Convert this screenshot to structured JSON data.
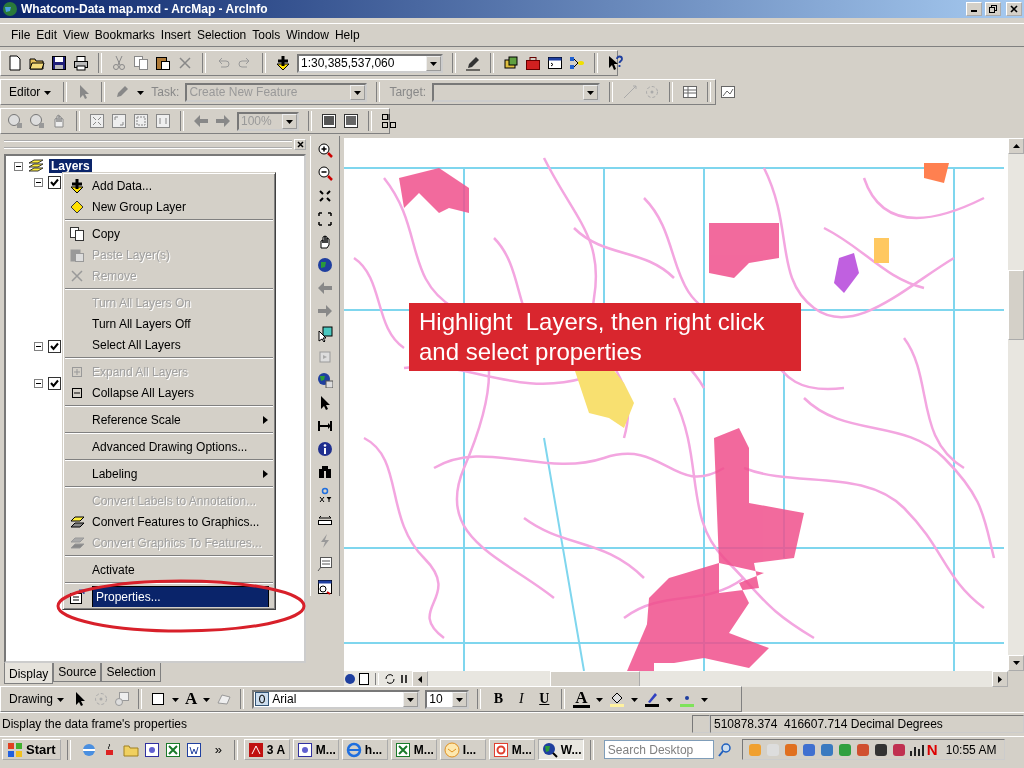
{
  "window": {
    "title": "Whatcom-Data map.mxd - ArcMap - ArcInfo"
  },
  "menu_bar": [
    "File",
    "Edit",
    "View",
    "Bookmarks",
    "Insert",
    "Selection",
    "Tools",
    "Window",
    "Help"
  ],
  "standard_toolbar": {
    "scale": "1:30,385,537,060"
  },
  "editor_toolbar": {
    "editor": "Editor",
    "task_label": "Task:",
    "task": "Create New Feature",
    "target_label": "Target:"
  },
  "layout_toolbar": {
    "zoom": "100%"
  },
  "toc": {
    "root": {
      "label": "Layers",
      "selected": true,
      "expanded": true
    },
    "layers": [
      {
        "checked": true,
        "expanded": true
      },
      {
        "checked": true,
        "expanded": true
      },
      {
        "checked": true,
        "expanded": true
      }
    ],
    "tabs": [
      {
        "label": "Display",
        "selected": true
      },
      {
        "label": "Source",
        "selected": false
      },
      {
        "label": "Selection",
        "selected": false
      }
    ]
  },
  "context_menu": {
    "sections": [
      [
        {
          "label": "Add Data...",
          "disabled": false,
          "selected": false,
          "submenu": false,
          "kind": "add"
        },
        {
          "label": "New Group Layer",
          "disabled": false,
          "selected": false,
          "submenu": false,
          "kind": "group"
        }
      ],
      [
        {
          "label": "Copy",
          "disabled": false,
          "selected": false,
          "submenu": false,
          "kind": "copy"
        },
        {
          "label": "Paste Layer(s)",
          "disabled": true,
          "selected": false,
          "submenu": false,
          "kind": "paste"
        },
        {
          "label": "Remove",
          "disabled": true,
          "selected": false,
          "submenu": false,
          "kind": "remove"
        }
      ],
      [
        {
          "label": "Turn All Layers On",
          "disabled": true,
          "selected": false,
          "submenu": false,
          "kind": "none"
        },
        {
          "label": "Turn All Layers Off",
          "disabled": false,
          "selected": false,
          "submenu": false,
          "kind": "none"
        },
        {
          "label": "Select All Layers",
          "disabled": false,
          "selected": false,
          "submenu": false,
          "kind": "none"
        }
      ],
      [
        {
          "label": "Expand All Layers",
          "disabled": true,
          "selected": false,
          "submenu": false,
          "kind": "expand"
        },
        {
          "label": "Collapse All Layers",
          "disabled": false,
          "selected": false,
          "submenu": false,
          "kind": "collapse"
        }
      ],
      [
        {
          "label": "Reference Scale",
          "disabled": false,
          "selected": false,
          "submenu": true,
          "kind": "none"
        }
      ],
      [
        {
          "label": "Advanced Drawing Options...",
          "disabled": false,
          "selected": false,
          "submenu": false,
          "kind": "none"
        }
      ],
      [
        {
          "label": "Labeling",
          "disabled": false,
          "selected": false,
          "submenu": true,
          "kind": "none"
        }
      ],
      [
        {
          "label": "Convert Labels to Annotation...",
          "disabled": true,
          "selected": false,
          "submenu": false,
          "kind": "none"
        },
        {
          "label": "Convert Features to Graphics...",
          "disabled": false,
          "selected": false,
          "submenu": false,
          "kind": "features"
        },
        {
          "label": "Convert Graphics To Features...",
          "disabled": true,
          "selected": false,
          "submenu": false,
          "kind": "features"
        }
      ],
      [
        {
          "label": "Activate",
          "disabled": false,
          "selected": false,
          "submenu": false,
          "kind": "none"
        }
      ],
      [
        {
          "label": "Properties...",
          "disabled": false,
          "selected": true,
          "submenu": false,
          "kind": "properties"
        }
      ]
    ]
  },
  "map": {
    "callout": "Highlight  Layers, then right click and select properties"
  },
  "drawing_toolbar": {
    "label": "Drawing",
    "text_tool": "A",
    "font": "Arial",
    "size": "10",
    "format_buttons": [
      "B",
      "I",
      "U"
    ],
    "font_color": "A"
  },
  "status_bar": {
    "message": "Display the data frame's properties",
    "coordinates": "510878.374  416607.714 Decimal Degrees"
  },
  "taskbar": {
    "start": "Start",
    "more": "»",
    "buttons": [
      {
        "label": "3 A",
        "selected": false,
        "kind": "pdf"
      },
      {
        "label": "M...",
        "selected": false,
        "kind": "app"
      },
      {
        "label": "h...",
        "selected": false,
        "kind": "ie"
      },
      {
        "label": "M...",
        "selected": false,
        "kind": "excel"
      },
      {
        "label": "I...",
        "selected": false,
        "kind": "mail"
      },
      {
        "label": "M...",
        "selected": false,
        "kind": "office"
      },
      {
        "label": "W...",
        "selected": true,
        "kind": "globe"
      }
    ],
    "search_placeholder": "Search Desktop",
    "tray_label": "N",
    "clock": "10:55 AM"
  }
}
